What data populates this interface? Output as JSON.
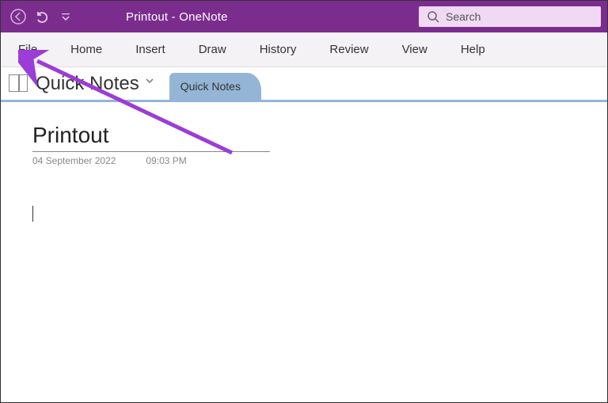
{
  "titlebar": {
    "title": "Printout  -  OneNote"
  },
  "search": {
    "placeholder": "Search"
  },
  "ribbon": {
    "tabs": [
      "File",
      "Home",
      "Insert",
      "Draw",
      "History",
      "Review",
      "View",
      "Help"
    ]
  },
  "notebook": {
    "section_title": "Quick Notes",
    "page_tab": "Quick Notes"
  },
  "page": {
    "title": "Printout",
    "date": "04 September 2022",
    "time": "09:03 PM"
  },
  "colors": {
    "brand": "#7b2d8e",
    "tab_accent": "#94b5d6",
    "search_bg": "#f0d9f2",
    "annotation": "#9b3dd6"
  }
}
